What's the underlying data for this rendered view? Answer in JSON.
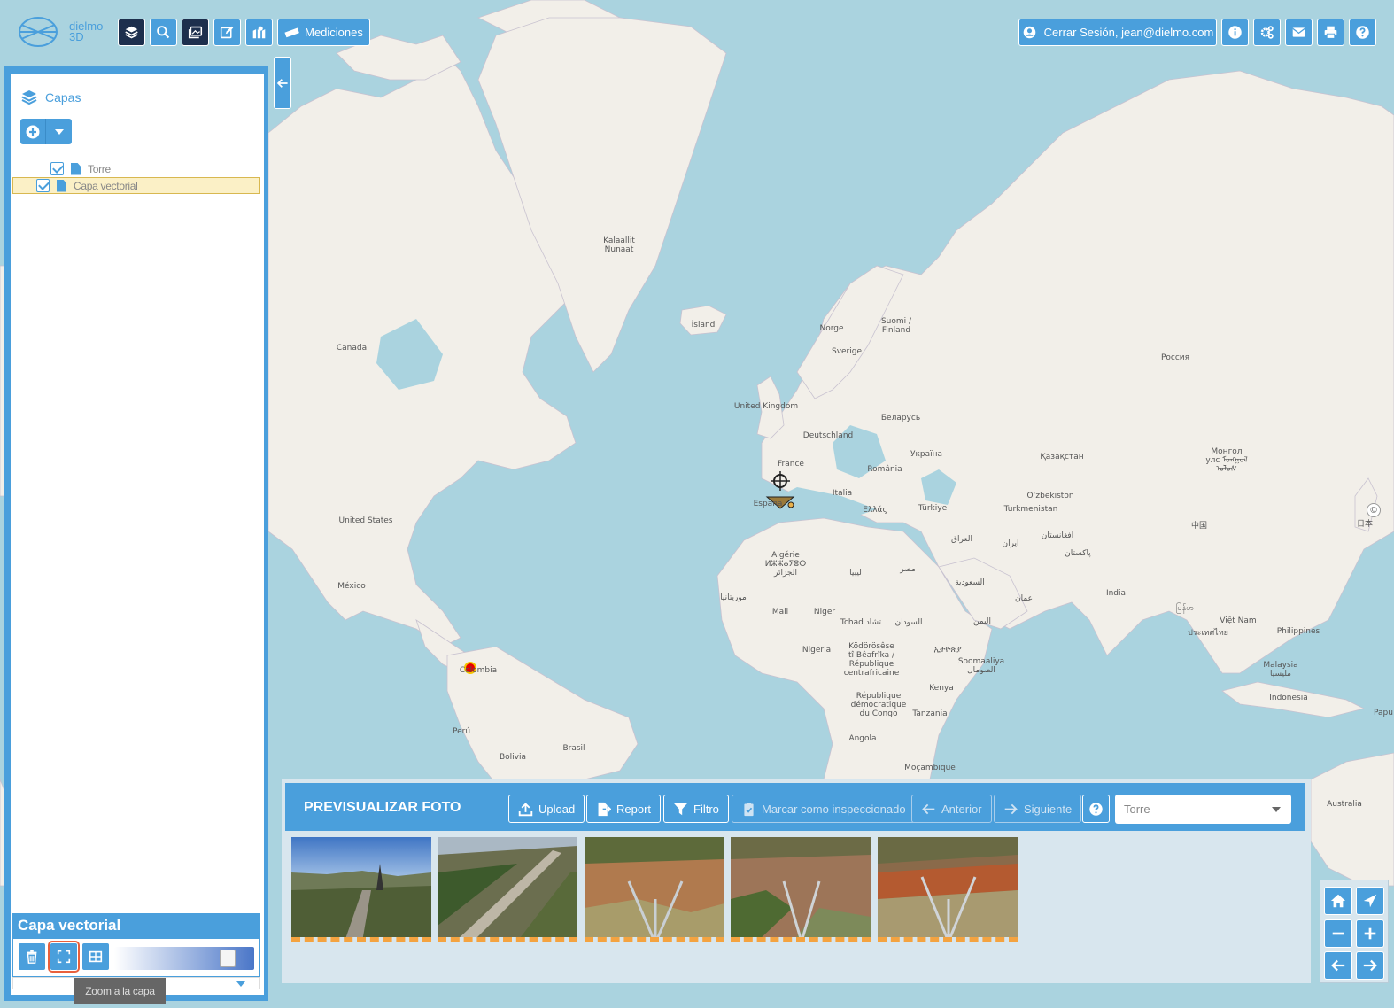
{
  "app": {
    "logo_line1": "dielmo",
    "logo_line2": "3D"
  },
  "toolbar": {
    "mediciones_label": "Mediciones"
  },
  "user": {
    "session_label": "Cerrar Sesión, jean@dielmo.com"
  },
  "sidebar": {
    "title": "Capas",
    "layers": [
      {
        "label": "Torre",
        "checked": true,
        "selected": false
      },
      {
        "label": "Capa vectorial",
        "checked": true,
        "selected": true
      }
    ]
  },
  "layer_panel": {
    "title": "Capa vectorial",
    "opacity": 0.85,
    "tooltip": "Zoom a la capa"
  },
  "photo_panel": {
    "title": "PREVISUALIZAR FOTO",
    "upload_label": "Upload",
    "report_label": "Report",
    "filter_label": "Filtro",
    "mark_label": "Marcar como inspeccionado",
    "prev_label": "Anterior",
    "next_label": "Siguiente",
    "select_value": "Torre"
  },
  "map_labels": {
    "greenland": "Kalaallit\nNunaat",
    "iceland": "Ísland",
    "canada": "Canada",
    "usa": "United States",
    "mexico": "México",
    "colombia": "Colombia",
    "peru": "Perú",
    "bolivia": "Bolivia",
    "brasil": "Brasil",
    "uk": "United Kingdom",
    "norge": "Norge",
    "sverige": "Sverige",
    "finland": "Suomi /\nFinland",
    "deutschland": "Deutschland",
    "france": "France",
    "espana": "España",
    "italia": "Italia",
    "romania": "România",
    "belarus": "Беларусь",
    "ukraine": "Україна",
    "greece": "Ελλάς",
    "turkiye": "Türkiye",
    "russia": "Россия",
    "kazakhstan": "Қазақстан",
    "uzbekistan": "O‘zbekiston",
    "turkmenistan": "Turkmenistan",
    "mongolia": "Монгол\nулс ᠮᠣᠩᠭᠣᠯ\nᠤᠯᠤᠰ",
    "china": "中国",
    "japan": "日本",
    "iraq": "العراق",
    "iran": "ایران",
    "afghanistan": "افغانستان",
    "pakistan": "پاکستان",
    "india": "India",
    "myanmar": "မြန်မာ",
    "thailand": "ประเทศไทย",
    "vietnam": "Việt Nam",
    "philippines": "Philippines",
    "malaysia": "Malaysia\nمليسيا",
    "indonesia": "Indonesia",
    "algeria": "Algérie\nⵍⵣⵣⴰⵢⴻⵔ\nالجزائر",
    "libya": "ليبيا",
    "egypt": "مصر",
    "saudi": "السعودية",
    "oman": "عمان",
    "yemen": "اليمن",
    "mauritania": "موريتانيا",
    "mali": "Mali",
    "niger": "Niger",
    "tchad": "Tchad تشاد",
    "sudan": "السودان",
    "ethiopia": "ኢትዮጵያ",
    "somalia": "Soomaaliya\nالصومال",
    "nigeria": "Nigeria",
    "car": "Ködörösêse\ntî Bêafrîka /\nRépublique\ncentrafricaine",
    "kenya": "Kenya",
    "drc": "République\ndémocratique\ndu Congo",
    "tanzania": "Tanzania",
    "angola": "Angola",
    "mocambique": "Moçambique",
    "australia": "Australia",
    "papua": "Papu"
  }
}
